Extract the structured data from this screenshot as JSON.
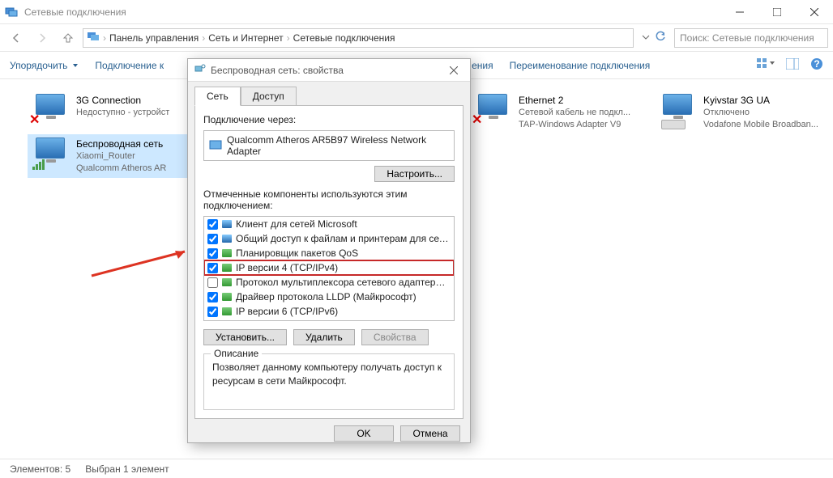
{
  "window": {
    "title": "Сетевые подключения"
  },
  "breadcrumbs": {
    "root": "Панель управления",
    "mid": "Сеть и Интернет",
    "leaf": "Сетевые подключения"
  },
  "search": {
    "placeholder": "Поиск: Сетевые подключения"
  },
  "commandbar": {
    "organize": "Упорядочить",
    "connect": "Подключение к",
    "disable": "ения",
    "rename": "Переименование подключения"
  },
  "connections": [
    {
      "name": "3G Connection",
      "status": "Недоступно - устройст",
      "adapter": ""
    },
    {
      "name": "Беспроводная сеть",
      "status": "Xiaomi_Router",
      "adapter": "Qualcomm Atheros AR"
    },
    {
      "name": "Ethernet 2",
      "status": "Сетевой кабель не подкл...",
      "adapter": "TAP-Windows Adapter V9"
    },
    {
      "name": "Kyivstar 3G UA",
      "status": "Отключено",
      "adapter": "Vodafone Mobile Broadban..."
    }
  ],
  "dialog": {
    "title": "Беспроводная сеть: свойства",
    "tab_network": "Сеть",
    "tab_access": "Доступ",
    "connect_using": "Подключение через:",
    "adapter": "Qualcomm Atheros AR5B97 Wireless Network Adapter",
    "configure": "Настроить...",
    "components_label": "Отмеченные компоненты используются этим подключением:",
    "components": [
      {
        "checked": true,
        "label": "Клиент для сетей Microsoft",
        "icon": "mon"
      },
      {
        "checked": true,
        "label": "Общий доступ к файлам и принтерам для сетей Mi",
        "icon": "mon"
      },
      {
        "checked": true,
        "label": "Планировщик пакетов QoS",
        "icon": "net"
      },
      {
        "checked": true,
        "label": "IP версии 4 (TCP/IPv4)",
        "icon": "net",
        "highlight": true
      },
      {
        "checked": false,
        "label": "Протокол мультиплексора сетевого адаптера (Ма",
        "icon": "net"
      },
      {
        "checked": true,
        "label": "Драйвер протокола LLDP (Майкрософт)",
        "icon": "net"
      },
      {
        "checked": true,
        "label": "IP версии 6 (TCP/IPv6)",
        "icon": "net"
      }
    ],
    "install": "Установить...",
    "uninstall": "Удалить",
    "properties": "Свойства",
    "description_legend": "Описание",
    "description_text": "Позволяет данному компьютеру получать доступ к ресурсам в сети Майкрософт.",
    "ok": "OK",
    "cancel": "Отмена"
  },
  "statusbar": {
    "count": "Элементов: 5",
    "selected": "Выбран 1 элемент"
  }
}
